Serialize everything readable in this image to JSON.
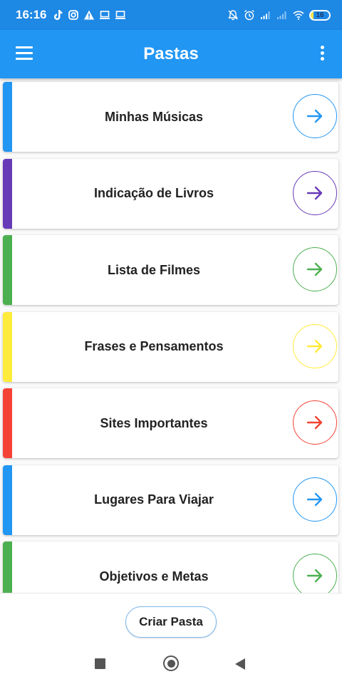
{
  "status_bar": {
    "time": "16:16",
    "battery": "16",
    "battery_level": 0.16,
    "left_icons": [
      "tiktok-icon",
      "instagram-icon",
      "alert-icon",
      "laptop-icon",
      "laptop-icon"
    ],
    "right_icons": [
      "bell-off-icon",
      "alarm-icon",
      "signal-icon",
      "signal-icon",
      "wifi-icon",
      "battery-icon"
    ]
  },
  "app_bar": {
    "title": "Pastas",
    "background": "#2196f3",
    "left_icon": "menu-icon",
    "right_icon": "more-vert-icon"
  },
  "folders": [
    {
      "name": "Minhas Músicas",
      "color": "#2196f3",
      "icon": "arrow-right-icon"
    },
    {
      "name": "Indicação de Livros",
      "color": "#673ab7",
      "icon": "arrow-right-icon"
    },
    {
      "name": "Lista de Filmes",
      "color": "#4caf50",
      "icon": "arrow-right-icon"
    },
    {
      "name": "Frases e Pensamentos",
      "color": "#ffeb3b",
      "icon": "arrow-right-icon"
    },
    {
      "name": "Sites Importantes",
      "color": "#f44336",
      "icon": "arrow-right-icon"
    },
    {
      "name": "Lugares Para Viajar",
      "color": "#2196f3",
      "icon": "arrow-right-icon"
    },
    {
      "name": "Objetivos e Metas",
      "color": "#4caf50",
      "icon": "arrow-right-icon"
    }
  ],
  "create_button": {
    "label": "Criar Pasta"
  },
  "nav_bar": {
    "icons": [
      "recents-icon",
      "home-icon",
      "back-icon"
    ]
  }
}
